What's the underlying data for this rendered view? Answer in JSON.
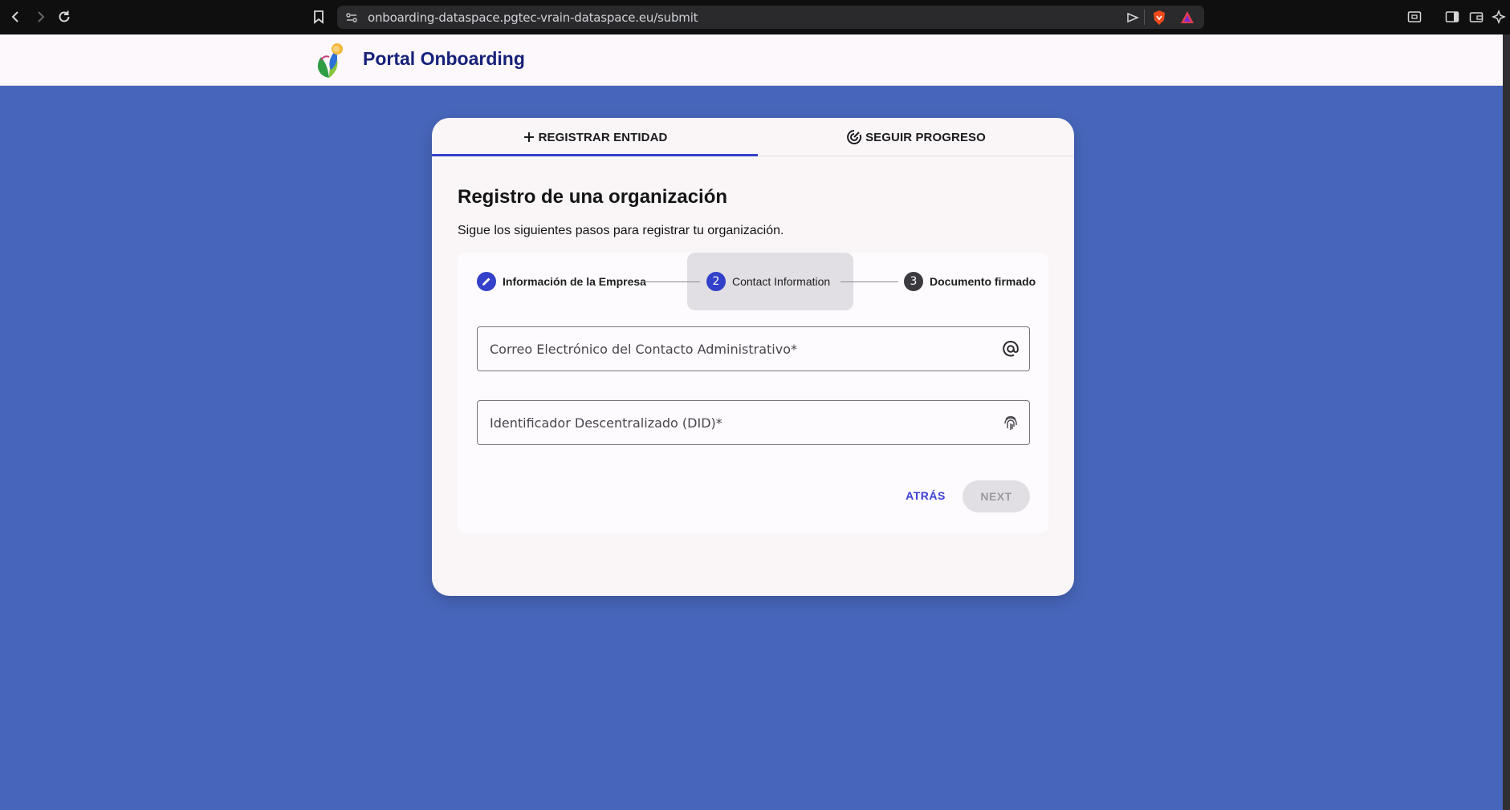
{
  "browser": {
    "url": "onboarding-dataspace.pgtec-vrain-dataspace.eu/submit"
  },
  "app": {
    "title": "Portal Onboarding"
  },
  "tabs": [
    {
      "label": "REGISTRAR ENTIDAD",
      "icon": "plus-icon",
      "active": true
    },
    {
      "label": "SEGUIR PROGRESO",
      "icon": "track-changes-icon",
      "active": false
    }
  ],
  "form": {
    "title": "Registro de una organización",
    "subtitle": "Sigue los siguientes pasos para registrar tu organización."
  },
  "stepper": {
    "steps": [
      {
        "label": "Información de la Empresa",
        "state": "completed",
        "icon": "edit-icon"
      },
      {
        "label": "Contact Information",
        "number": "2",
        "state": "active"
      },
      {
        "label": "Documento firmado",
        "number": "3",
        "state": "pending"
      }
    ]
  },
  "fields": {
    "email": {
      "placeholder": "Correo Electrónico del Contacto Administrativo*",
      "value": "",
      "icon": "at-sign-icon"
    },
    "did": {
      "placeholder": "Identificador Descentralizado (DID)*",
      "value": "",
      "icon": "fingerprint-icon"
    }
  },
  "actions": {
    "back_label": "ATRÁS",
    "next_label": "NEXT",
    "next_disabled": true
  },
  "colors": {
    "page_background": "#4766bb",
    "accent": "#3340c9",
    "title_color": "#16217a"
  }
}
